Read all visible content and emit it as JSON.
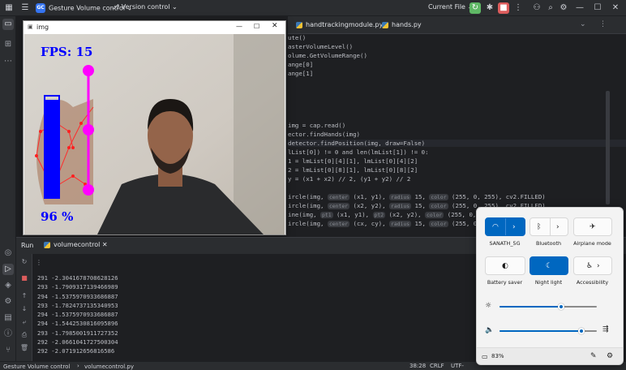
{
  "toolbar": {
    "project_badge": "GC",
    "project": "Gesture Volume control",
    "vcs": "Version control",
    "run_config": "Current File"
  },
  "tabs": [
    {
      "label": "handtrackingmodule.py"
    },
    {
      "label": "hands.py"
    }
  ],
  "code_lines": [
    {
      "a": "ute()"
    },
    {
      "a": "asterVolumeLevel()"
    },
    {
      "a": "olume.GetVolumeRange()"
    },
    {
      "a": "ange[0]"
    },
    {
      "a": "ange[1]"
    },
    {
      "a": "img = cap.read()"
    },
    {
      "a": "ector.findHands(img)"
    },
    {
      "a": "detector.findPosition(img, draw=False)"
    },
    {
      "a": "lList[0]) != 0 and len(lmList[1]) != 0:"
    },
    {
      "a": "1 = lmList[0][4][1], lmList[0][4][2]"
    },
    {
      "a": "2 = lmList[0][8][1], lmList[0][8][2]"
    },
    {
      "a": "y = (x1 + x2) // 2, (y1 + y2) // 2"
    },
    {
      "a": "ircle(img, ",
      "h1": "center",
      "b": " (x1, y1), ",
      "h2": "radius",
      "c": " 15, ",
      "h3": "color",
      "d": " (255, 0, 255), cv2.FILLED)"
    },
    {
      "a": "ircle(img, ",
      "h1": "center",
      "b": " (x2, y2), ",
      "h2": "radius",
      "c": " 15, ",
      "h3": "color",
      "d": " (255, 0, 255), cv2.FILLED)"
    },
    {
      "a": "ine(img, ",
      "h1": "pt1",
      "b": " (x1, y1), ",
      "h2": "pt2",
      "c": " (x2, y2), ",
      "h3": "color",
      "d": " (255, 0, 255), 3)"
    },
    {
      "a": "ircle(img, ",
      "h1": "center",
      "b": " (cx, cy), ",
      "h2": "radius",
      "c": " 15, ",
      "h3": "color",
      "d": " (255, 0, 255), cv2.FILLED)"
    }
  ],
  "image_window": {
    "title": "img",
    "fps_label": "FPS: 15",
    "volume_label": "96 %",
    "volume_fraction": 0.96
  },
  "run_panel": {
    "tab_label": "Run",
    "config_label": "volumecontrol",
    "console_lines": [
      "291 -2.3041678708628126",
      "293 -1.7909317139466989",
      "294 -1.5375970933686887",
      "293 -1.7824737135340953",
      "294 -1.5375970933686887",
      "294 -1.5442530816095896",
      "293 -1.7985001911727352",
      "292 -2.0661041727500304",
      "292 -2.071912656816586"
    ]
  },
  "statusbar": {
    "project": "Gesture Volume control",
    "file": "volumecontrol.py",
    "position": "38:28",
    "line_ending": "CRLF",
    "encoding": "UTF-"
  },
  "quick_settings": {
    "tiles": [
      {
        "label": "SANATH_5G",
        "icon": "wifi-icon",
        "on": true
      },
      {
        "label": "Bluetooth",
        "icon": "bluetooth-icon",
        "on": false
      },
      {
        "label": "Airplane mode",
        "icon": "airplane-icon",
        "on": false
      },
      {
        "label": "Battery saver",
        "icon": "battery-saver-icon",
        "on": false
      },
      {
        "label": "Night light",
        "icon": "night-light-icon",
        "on": true
      },
      {
        "label": "Accessibility",
        "icon": "accessibility-icon",
        "on": false
      }
    ],
    "brightness": 0.63,
    "volume": 0.84,
    "battery": "83%"
  },
  "colors": {
    "accent_blue": "#0067c0",
    "magenta": "#ff00ff",
    "volume_bar": "#0000ff",
    "stop_red": "#db5c5c",
    "run_green": "#5fb865"
  }
}
